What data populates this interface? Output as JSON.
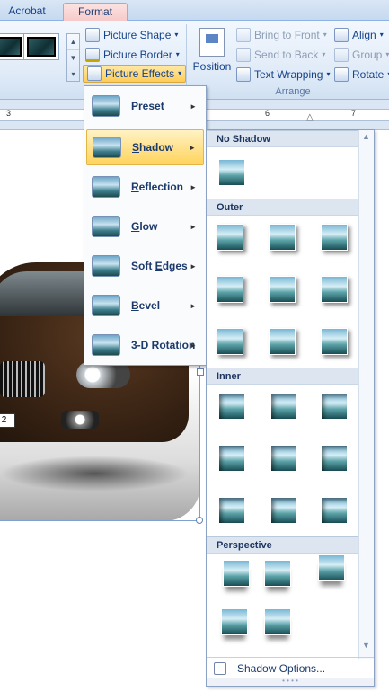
{
  "tabs": {
    "acrobat": "Acrobat",
    "format": "Format"
  },
  "ribbon": {
    "picture_shape": "Picture Shape",
    "picture_border": "Picture Border",
    "picture_effects": "Picture Effects",
    "position": "Position",
    "bring_to_front": "Bring to Front",
    "send_to_back": "Send to Back",
    "text_wrapping": "Text Wrapping",
    "align": "Align",
    "group": "Group",
    "rotate": "Rotate",
    "arrange_label": "Arrange"
  },
  "ruler": {
    "ticks": [
      "3",
      "6",
      "7"
    ]
  },
  "photo": {
    "plate_text": "2"
  },
  "effects_menu": {
    "items": [
      {
        "label": "Preset",
        "accel": "P",
        "rest": "reset"
      },
      {
        "label": "Shadow",
        "accel": "S",
        "rest": "hadow"
      },
      {
        "label": "Reflection",
        "accel": "R",
        "rest": "eflection"
      },
      {
        "label": "Glow",
        "accel": "G",
        "rest": "low"
      },
      {
        "label": "Soft Edges",
        "accel": "E",
        "pre": "Soft ",
        "rest": "dges"
      },
      {
        "label": "Bevel",
        "accel": "B",
        "rest": "evel"
      },
      {
        "label": "3-D Rotation",
        "accel": "D",
        "pre": "3-",
        "rest": " Rotation"
      }
    ]
  },
  "shadow_menu": {
    "sections": {
      "none": "No Shadow",
      "outer": "Outer",
      "inner": "Inner",
      "perspective": "Perspective"
    },
    "footer_label": "Shadow Options...",
    "footer_accel": "O"
  }
}
